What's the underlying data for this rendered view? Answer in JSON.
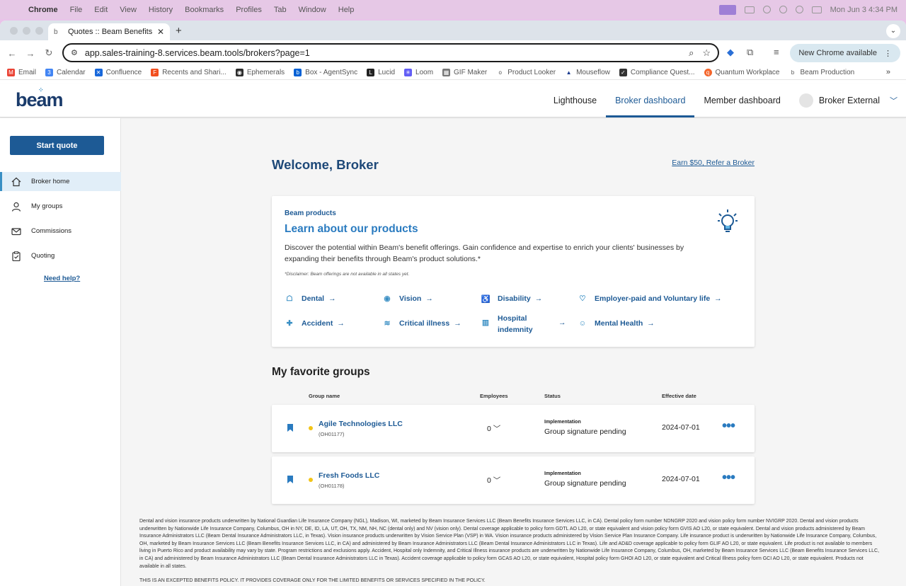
{
  "menubar": {
    "app": "Chrome",
    "items": [
      "File",
      "Edit",
      "View",
      "History",
      "Bookmarks",
      "Profiles",
      "Tab",
      "Window",
      "Help"
    ],
    "clock": "Mon Jun 3  4:34 PM"
  },
  "browser": {
    "tab_title": "Quotes :: Beam Benefits",
    "url": "app.sales-training-8.services.beam.tools/brokers?page=1",
    "update_label": "New Chrome available",
    "bookmarks": [
      "Email",
      "Calendar",
      "Confluence",
      "Recents and Shari...",
      "Ephemerals",
      "Box - AgentSync",
      "Lucid",
      "Loom",
      "GIF Maker",
      "Product Looker",
      "Mouseflow",
      "Compliance Quest...",
      "Quantum Workplace",
      "Beam Production"
    ]
  },
  "header": {
    "logo": "beam",
    "nav": [
      "Lighthouse",
      "Broker dashboard",
      "Member dashboard"
    ],
    "user": "Broker External"
  },
  "sidebar": {
    "start_quote": "Start quote",
    "items": [
      "Broker home",
      "My groups",
      "Commissions",
      "Quoting"
    ],
    "need_help": "Need help?"
  },
  "main": {
    "welcome": "Welcome, Broker",
    "refer_link": "Earn $50, Refer a Broker",
    "products": {
      "eyebrow": "Beam products",
      "heading": "Learn about our products",
      "description": "Discover the potential within Beam's benefit offerings. Gain confidence and expertise to enrich your clients' businesses by expanding their benefits through Beam's product solutions.*",
      "disclaimer": "*Disclaimer: Beam offerings are not available in all states yet.",
      "links": [
        "Dental",
        "Vision",
        "Disability",
        "Employer-paid and Voluntary life",
        "Accident",
        "Critical illness",
        "Hospital indemnity",
        "Mental Health"
      ]
    },
    "favorites": {
      "title": "My favorite groups",
      "columns": [
        "Group name",
        "Employees",
        "Status",
        "Effective date"
      ],
      "rows": [
        {
          "name": "Agile Technologies LLC",
          "id": "(OH01177)",
          "employees": "0",
          "status_label": "Implementation",
          "status": "Group signature pending",
          "effective": "2024-07-01"
        },
        {
          "name": "Fresh Foods LLC",
          "id": "(OH01178)",
          "employees": "0",
          "status_label": "Implementation",
          "status": "Group signature pending",
          "effective": "2024-07-01"
        }
      ]
    },
    "footer": "Dental and vision insurance products underwritten by National Guardian Life Insurance Company (NGL), Madison, WI, marketed by Beam Insurance Services LLC (Beam Benefits Insurance Services LLC, in CA). Dental policy form number NDNGRP 2020 and vision policy form number NVIGRP 2020. Dental and vision products underwritten by Nationwide Life Insurance Company, Columbus, OH in NY, DE, ID, LA, UT, OH, TX, NM, NH, NC (dental only) and NV (vision only). Dental coverage applicable to policy form GDTL AO L20, or state equivalent and vision policy form GVIS AO L20, or state equivalent. Dental and vision products administered by Beam Insurance Administrators LLC (Beam Dental Insurance Administrators LLC, in Texas). Vision insurance products underwritten by Vision Service Plan (VSP) in WA. Vision insurance products administered by Vision Service Plan Insurance Company. Life insurance product is underwritten by Nationwide Life Insurance Company, Columbus, OH, marketed by Beam Insurance Services LLC (Beam Benefits Insurance Services LLC, in CA) and administered by Beam Insurance Administrators LLC (Beam Dental Insurance Administrators LLC in Texas). Life and AD&D coverage applicable to policy form GLIF AO L20, or state equivalent. Life product is not available to members living in Puerto Rico and product availability may vary by state. Program restrictions and exclusions apply. Accident, Hospital only Indemnity, and Critical Illness insurance products are underwritten by Nationwide Life Insurance Company, Columbus, OH, marketed by Beam Insurance Services LLC (Beam Benefits Insurance Services LLC, in CA) and administered by Beam Insurance Administrators LLC (Beam Dental Insurance Administrators LLC in Texas). Accident coverage applicable to policy form GCAS AO L20, or state equivalent, Hospital policy form GHOI AO L20, or state equivalent and Critical Illness policy form GCI AO L20, or state equivalent. Products not available in all states.",
    "footer2": "THIS IS AN EXCEPTED BENEFITS POLICY. IT PROVIDES COVERAGE ONLY FOR THE LIMITED BENEFITS OR SERVICES SPECIFIED IN THE POLICY."
  },
  "colors": {
    "brand_navy": "#1d4878",
    "brand_blue": "#1d5a95",
    "link_blue": "#2a7bc0",
    "status_dot": "#f2c417",
    "sidebar_active": "#e1eef8"
  }
}
